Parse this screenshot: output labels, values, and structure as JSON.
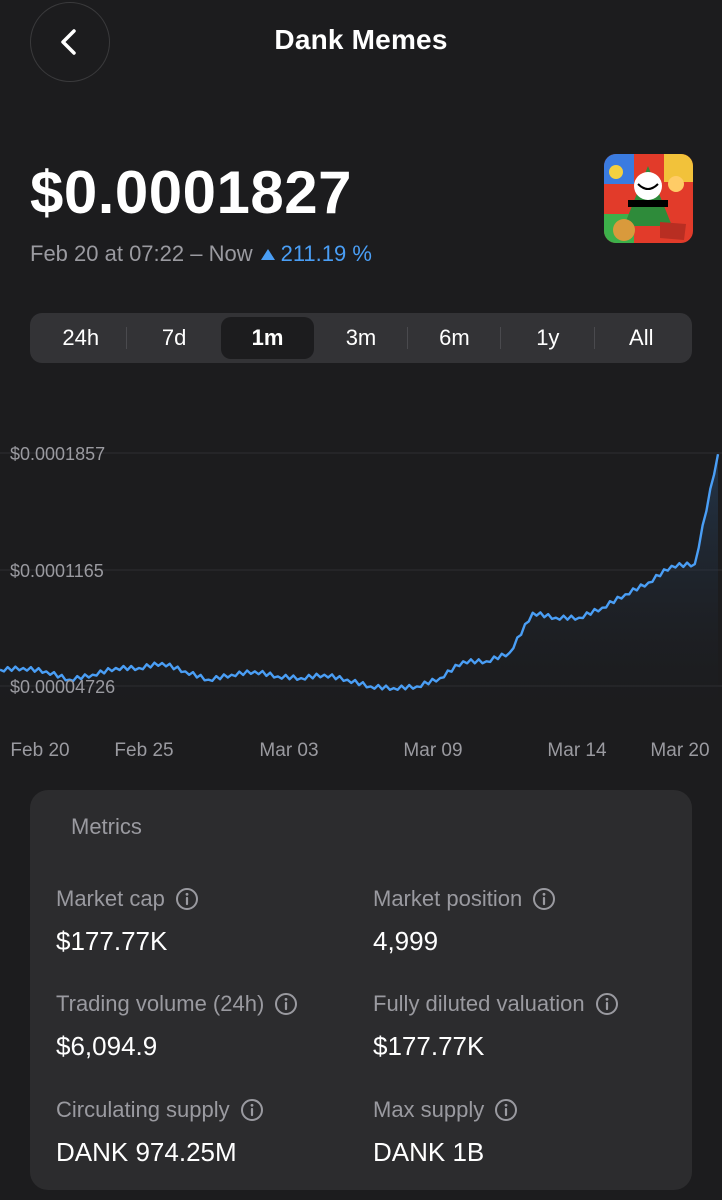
{
  "header": {
    "title": "Dank Memes"
  },
  "price": {
    "value": "$0.0001827",
    "period_label": "Feb 20 at 07:22 – Now",
    "change_text": "211.19 %"
  },
  "colors": {
    "accent": "#4a9ef5",
    "background": "#1c1c1e",
    "card": "#2c2c2e",
    "muted": "#9a9aa0"
  },
  "range_tabs": [
    {
      "label": "24h",
      "active": false
    },
    {
      "label": "7d",
      "active": false
    },
    {
      "label": "1m",
      "active": true
    },
    {
      "label": "3m",
      "active": false
    },
    {
      "label": "6m",
      "active": false
    },
    {
      "label": "1y",
      "active": false
    },
    {
      "label": "All",
      "active": false
    }
  ],
  "chart_data": {
    "type": "line",
    "title": "",
    "xlabel": "",
    "ylabel": "",
    "y_ticks": [
      "$0.0001857",
      "$0.0001165",
      "$0.00004726"
    ],
    "x_ticks": [
      "Feb 20",
      "Feb 25",
      "Mar 03",
      "Mar 09",
      "Mar 14",
      "Mar 20"
    ],
    "ylim": [
      3e-05,
      0.000195
    ],
    "series": [
      {
        "x": [
          "Feb 18",
          "Feb 19",
          "Feb 20",
          "Feb 21",
          "Feb 22",
          "Feb 23",
          "Feb 24",
          "Feb 25",
          "Feb 26",
          "Feb 27",
          "Feb 28",
          "Mar 01",
          "Mar 02",
          "Mar 03",
          "Mar 04",
          "Mar 05",
          "Mar 06",
          "Mar 07",
          "Mar 08",
          "Mar 09",
          "Mar 10",
          "Mar 11",
          "Mar 12",
          "Mar 13",
          "Mar 14",
          "Mar 15",
          "Mar 16",
          "Mar 17",
          "Mar 18",
          "Mar 19",
          "Mar 20",
          "Mar 21"
        ],
        "values": [
          5.7e-05,
          5.8e-05,
          5.6e-05,
          5.1e-05,
          5.4e-05,
          5.8e-05,
          5.8e-05,
          6.1e-05,
          5.6e-05,
          5.1e-05,
          5.4e-05,
          5.6e-05,
          5.3e-05,
          5.2e-05,
          5.4e-05,
          5.1e-05,
          4.7e-05,
          4.6e-05,
          4.7e-05,
          5.2e-05,
          6.2e-05,
          6.2e-05,
          6.7e-05,
          9.1e-05,
          8.8e-05,
          8.8e-05,
          9.4e-05,
          0.000102,
          0.000109,
          0.000119,
          0.00012,
          0.000185
        ]
      }
    ],
    "grid": true
  },
  "metrics": {
    "title": "Metrics",
    "items": [
      {
        "label": "Market cap",
        "value": "$177.77K"
      },
      {
        "label": "Market position",
        "value": "4,999"
      },
      {
        "label": "Trading volume (24h)",
        "value": "$6,094.9"
      },
      {
        "label": "Fully diluted valuation",
        "value": "$177.77K"
      },
      {
        "label": "Circulating supply",
        "value": "DANK 974.25M"
      },
      {
        "label": "Max supply",
        "value": "DANK 1B"
      }
    ]
  },
  "icons": {
    "back": "chevron-left-icon",
    "info": "info-icon"
  }
}
